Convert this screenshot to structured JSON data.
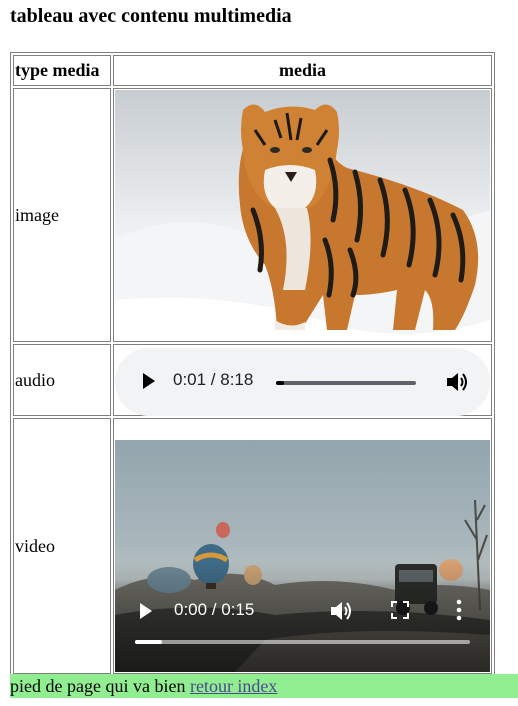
{
  "page": {
    "title": "tableau avec contenu multimedia"
  },
  "table": {
    "headers": {
      "type": "type media",
      "media": "media"
    },
    "rows": [
      {
        "type": "image"
      },
      {
        "type": "audio"
      },
      {
        "type": "video"
      }
    ]
  },
  "audio_player": {
    "time": "0:01 / 8:18",
    "progress_fraction": 0.06,
    "play_icon": "play-icon",
    "volume_icon": "volume-icon"
  },
  "video_player": {
    "time": "0:00 / 0:15",
    "progress_fraction": 0.08,
    "play_icon": "play-icon",
    "volume_icon": "volume-icon",
    "fullscreen_icon": "fullscreen-icon",
    "more_icon": "more-options-icon"
  },
  "footer": {
    "text": "pied de page qui va bien",
    "link_text": "retour index",
    "background": "#90ee90"
  }
}
